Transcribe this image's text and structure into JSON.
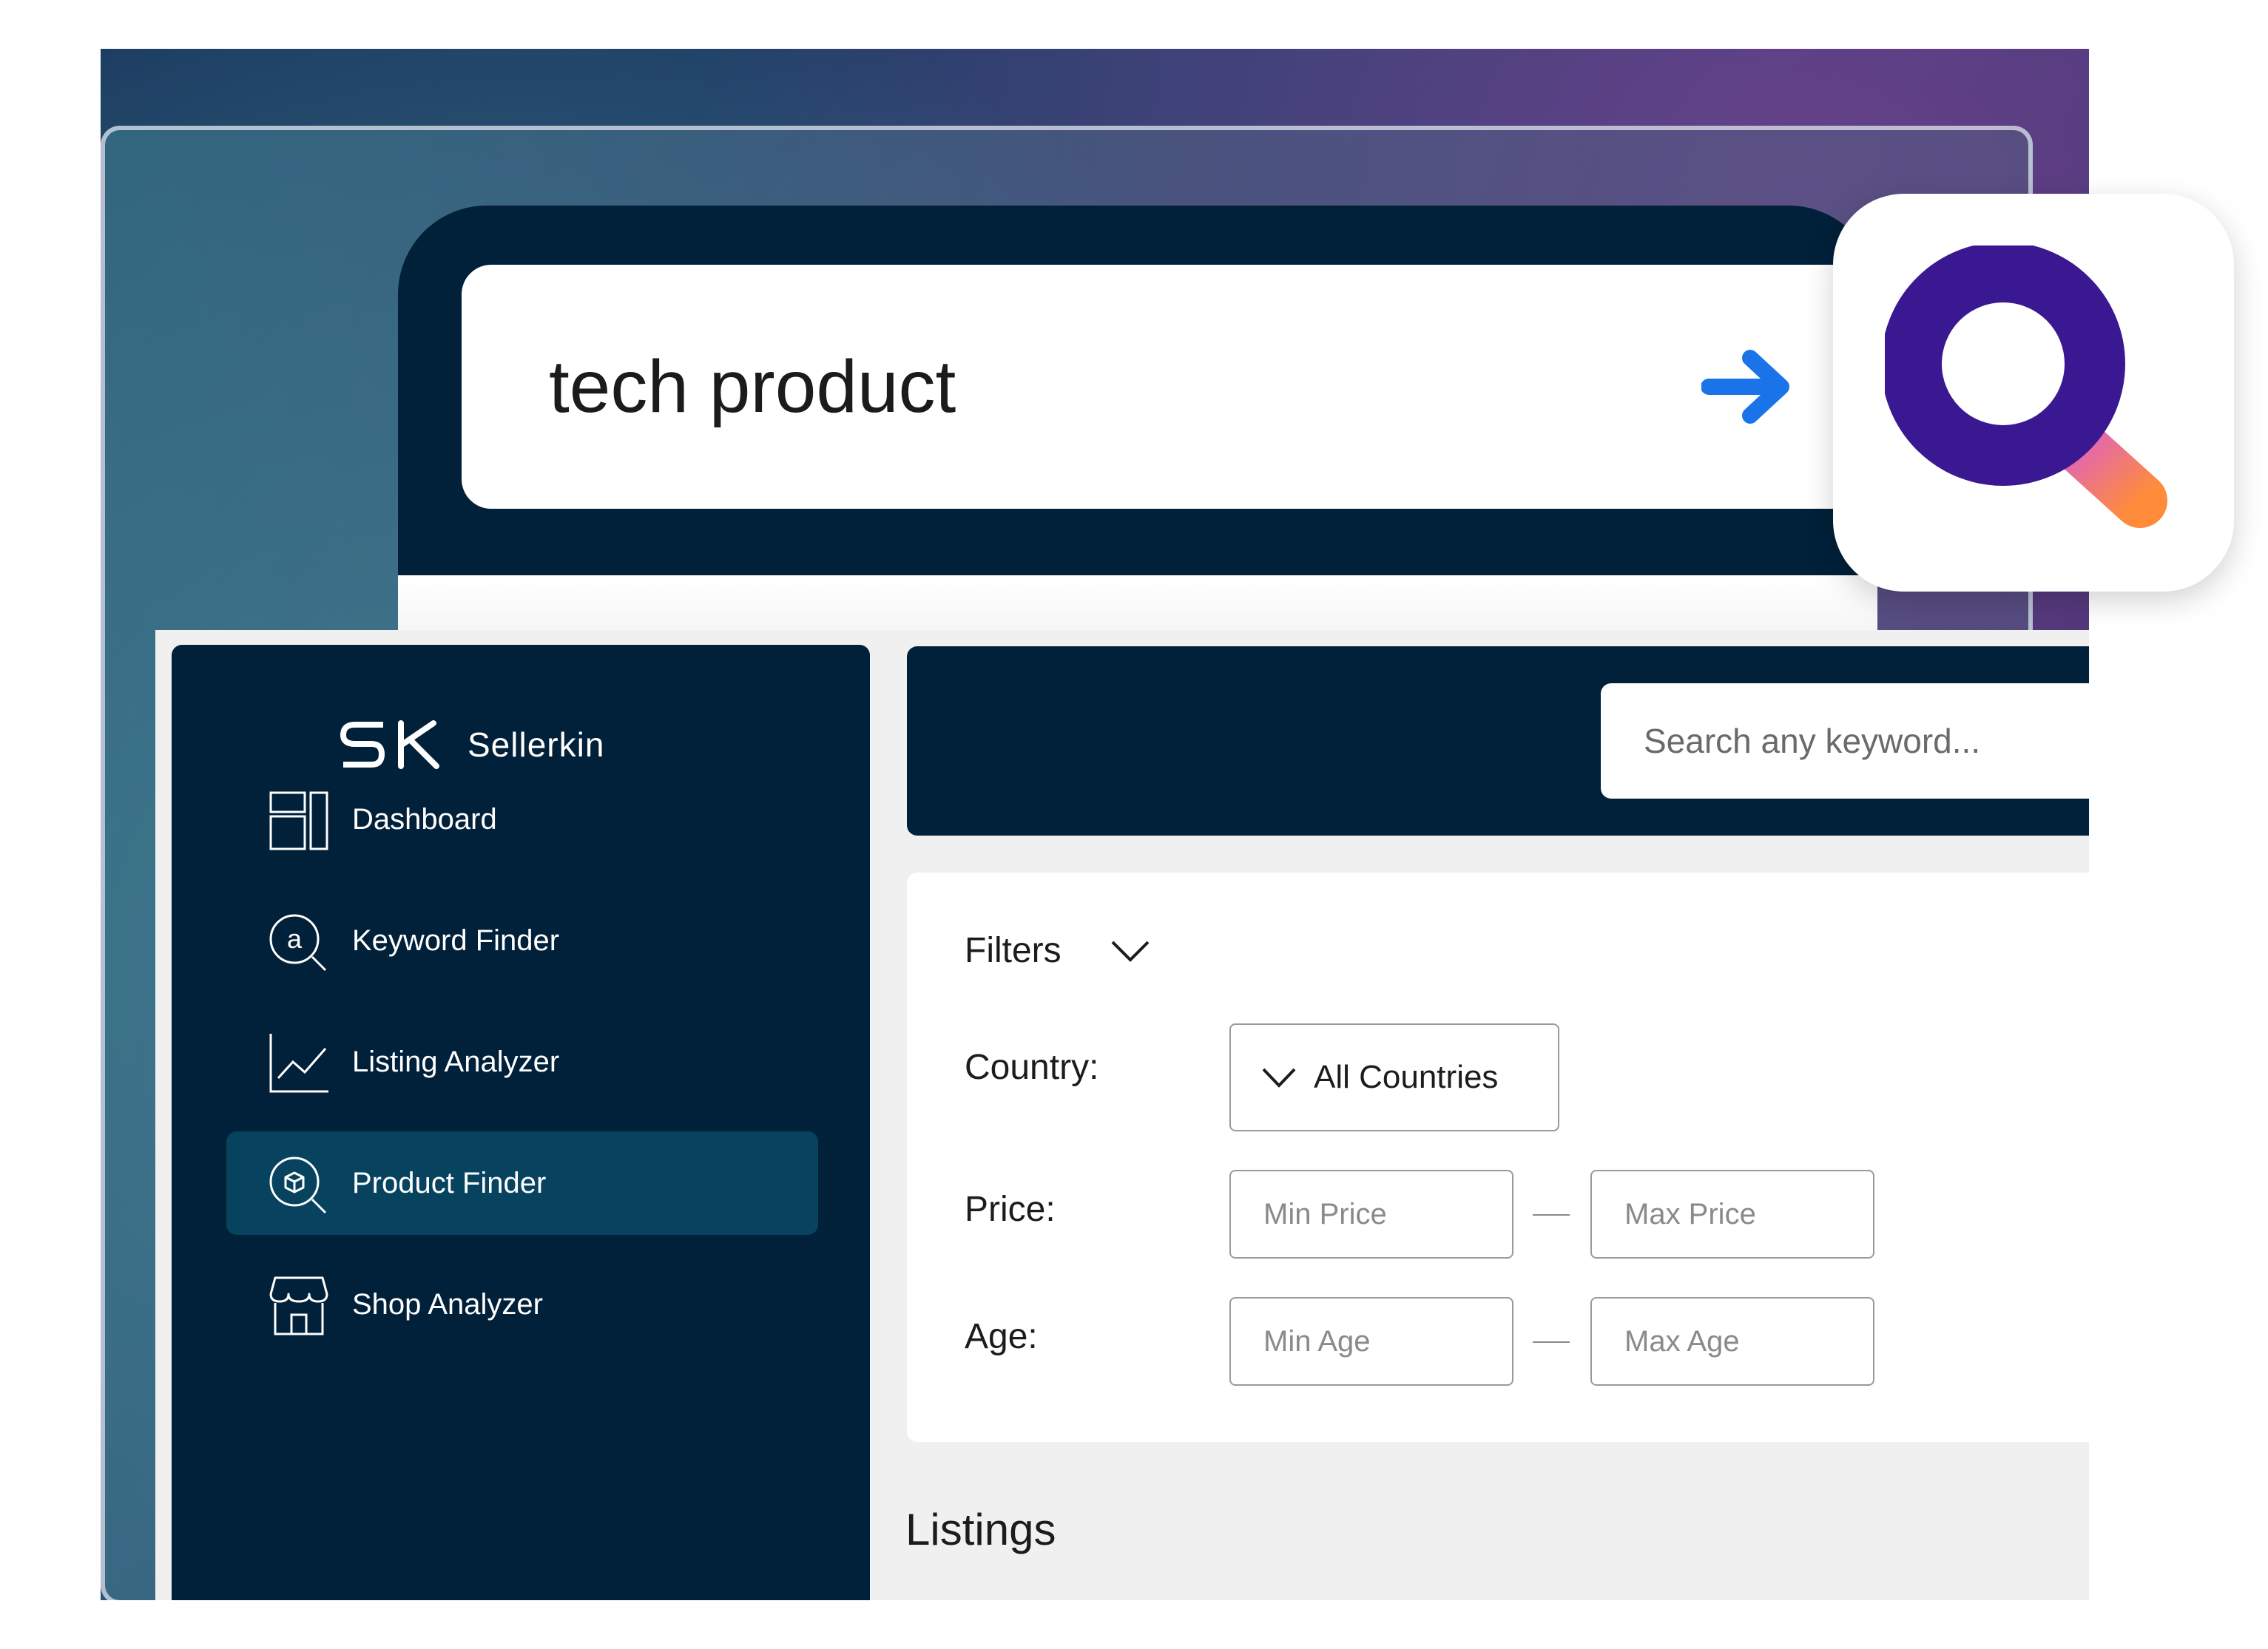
{
  "hero": {
    "query": "tech product",
    "submit_icon": "arrow-right-icon",
    "colors": {
      "card": "#012039",
      "arrow": "#1a73e8"
    }
  },
  "app_icon": {
    "icon": "magnifier-icon",
    "colors": {
      "ring": "#3a1892",
      "handle_start": "#d85bd6",
      "handle_end": "#ff8c3a"
    }
  },
  "brand": {
    "mark": "SK",
    "name": "Sellerkin"
  },
  "sidebar": {
    "items": [
      {
        "label": "Dashboard",
        "icon": "dashboard-icon",
        "active": false
      },
      {
        "label": "Keyword Finder",
        "icon": "keyword-search-icon",
        "active": false
      },
      {
        "label": "Listing Analyzer",
        "icon": "line-chart-icon",
        "active": false
      },
      {
        "label": "Product Finder",
        "icon": "product-search-icon",
        "active": true
      },
      {
        "label": "Shop Analyzer",
        "icon": "shop-icon",
        "active": false
      }
    ],
    "colors": {
      "background": "#012039",
      "active": "#07425e"
    }
  },
  "topbar": {
    "search_placeholder": "Search any keyword..."
  },
  "filters": {
    "title": "Filters",
    "country": {
      "label": "Country:",
      "value": "All Countries"
    },
    "price": {
      "label": "Price:",
      "min_placeholder": "Min Price",
      "max_placeholder": "Max Price"
    },
    "age": {
      "label": "Age:",
      "min_placeholder": "Min Age",
      "max_placeholder": "Max Age"
    }
  },
  "listings": {
    "title": "Listings"
  }
}
